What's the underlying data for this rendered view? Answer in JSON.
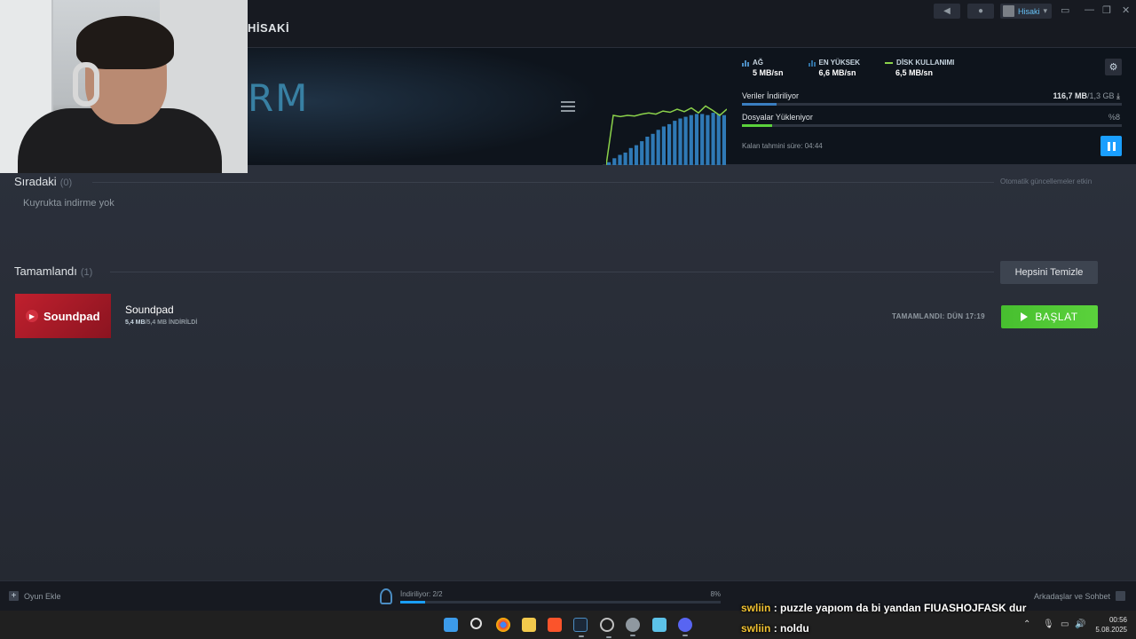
{
  "window": {
    "page_title": "HİSAKİ",
    "user_name": "Hisaki"
  },
  "stats": {
    "network": {
      "label": "AĞ",
      "value": "5 MB/sn"
    },
    "peak": {
      "label": "EN YÜKSEK",
      "value": "6,6 MB/sn"
    },
    "disk": {
      "label": "DİSK KULLANIMI",
      "value": "6,5 MB/sn"
    }
  },
  "progress": {
    "downloading": {
      "label": "Veriler İndiriliyor",
      "done": "116,7 MB",
      "total": "/1,3 GB",
      "fraction": 0.09
    },
    "uploading": {
      "label": "Dosyalar Yükleniyor",
      "pct": "%8",
      "fraction": 0.08
    },
    "eta": "Kalan tahmini süre: 04:44"
  },
  "graph_data": {
    "bars": [
      0.05,
      0.12,
      0.18,
      0.22,
      0.3,
      0.35,
      0.42,
      0.5,
      0.55,
      0.62,
      0.68,
      0.72,
      0.78,
      0.82,
      0.85,
      0.88,
      0.9,
      0.9,
      0.88,
      0.92,
      0.9,
      0.88
    ],
    "line": [
      0.0,
      0.8,
      0.78,
      0.8,
      0.79,
      0.82,
      0.84,
      0.82,
      0.87,
      0.85,
      0.9,
      0.86,
      0.92,
      0.84,
      0.95,
      0.88,
      0.8,
      0.9
    ]
  },
  "queue": {
    "title": "Sıradaki",
    "count": "(0)",
    "empty_text": "Kuyrukta indirme yok",
    "auto_updates": "Otomatik güncellemeler etkin"
  },
  "completed": {
    "title": "Tamamlandı",
    "count": "(1)",
    "clear_label": "Hepsini Temizle",
    "items": [
      {
        "name": "Soundpad",
        "thumb_text": "Soundpad",
        "size_done": "5,4 MB",
        "size_rest": "/5,4 MB İNDİRİLDİ",
        "completed_text": "TAMAMLANDI: DÜN 17:19",
        "play_label": "BAŞLAT"
      }
    ]
  },
  "statusbar": {
    "add_game": "Oyun Ekle",
    "downloading": "İndiriliyor: 2/2",
    "pct": "8%",
    "friends": "Arkadaşlar ve Sohbet"
  },
  "chat": [
    {
      "user": "swliin",
      "message": ": puzzle yapıom da bi yandan FIUASHOJFASK dur"
    },
    {
      "user": "swliin",
      "message": ": noldu"
    }
  ],
  "taskbar": {
    "time": "00:56",
    "date": "5.08.2025"
  },
  "colors": {
    "accent_blue": "#1a9fff",
    "play_green": "#5bd23c",
    "disk_line": "#8bd24a"
  }
}
